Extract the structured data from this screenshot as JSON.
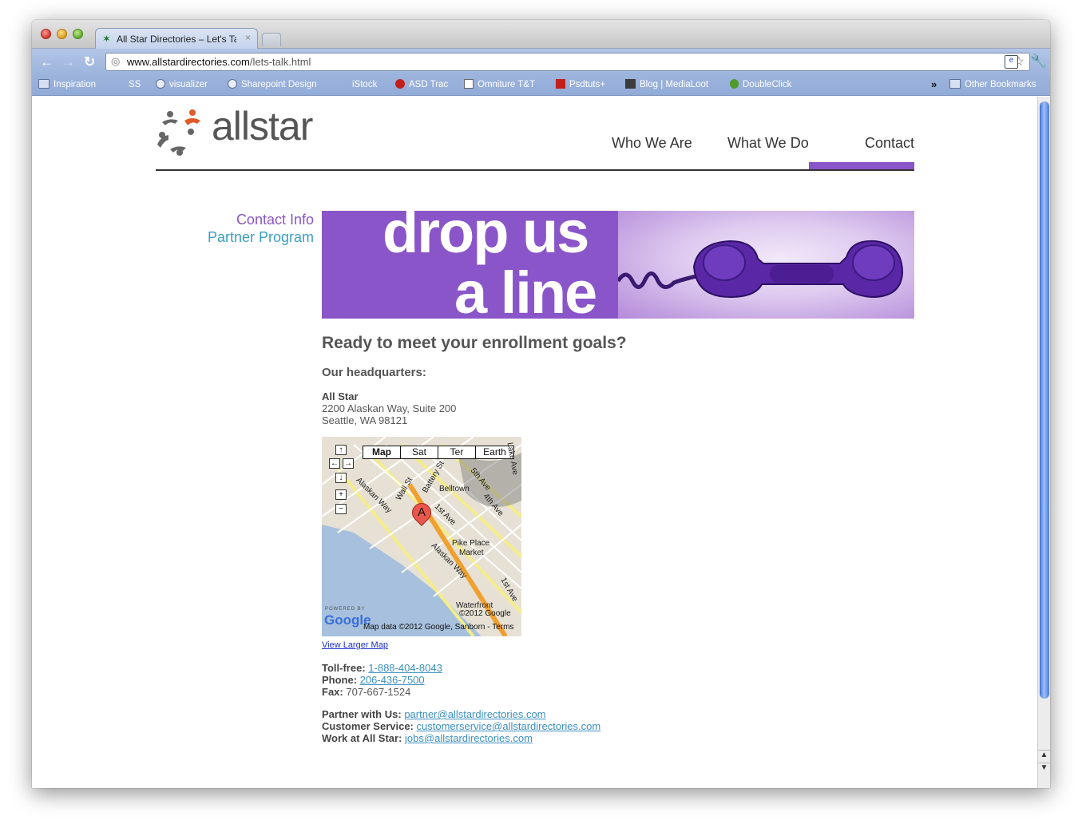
{
  "browser": {
    "tab_title": "All Star Directories – Let's Ta",
    "tab_close": "×",
    "url_host": "www.allstardirectories.com",
    "url_path": "/lets-talk.html",
    "bookmarks": [
      {
        "label": "Inspiration",
        "icon": "folder-icon"
      },
      {
        "label": "SS",
        "icon": "ss-icon"
      },
      {
        "label": "visualizer",
        "icon": "globe-icon"
      },
      {
        "label": "Sharepoint Design",
        "icon": "globe-icon"
      },
      {
        "label": "iStock",
        "icon": "istock-icon"
      },
      {
        "label": "ASD Trac",
        "icon": "trac-icon"
      },
      {
        "label": "Omniture T&T",
        "icon": "chart-icon"
      },
      {
        "label": "Psdtuts+",
        "icon": "psdtuts-icon"
      },
      {
        "label": "Blog | MediaLoot",
        "icon": "medialoot-icon"
      },
      {
        "label": "DoubleClick",
        "icon": "doubleclick-icon"
      }
    ],
    "bookmarks_overflow": "»",
    "other_bookmarks": "Other Bookmarks"
  },
  "site": {
    "logo_text": "allstar",
    "nav": {
      "who": "Who We Are",
      "what": "What We Do",
      "contact": "Contact"
    },
    "side_nav": {
      "contact_info": "Contact Info",
      "partner_program": "Partner Program"
    },
    "banner": {
      "line1": "drop us",
      "line2": "a line"
    },
    "heading": "Ready to meet your enrollment goals?",
    "subheading": "Our headquarters:",
    "address": {
      "name": "All Star",
      "street": "2200 Alaskan Way, Suite 200",
      "city": "Seattle, WA 98121"
    },
    "map": {
      "types": [
        "Map",
        "Sat",
        "Ter",
        "Earth"
      ],
      "labels": {
        "belltown": "Belltown",
        "pike": "Pike Place",
        "market": "Market",
        "alaskan1": "Alaskan Way",
        "alaskan2": "Alaskan Way",
        "wall": "Wall St",
        "battery": "Battery St",
        "first1": "1st Ave",
        "first2": "1st Ave",
        "fourth": "4th Ave",
        "fifth": "5th Ave",
        "lake": "Lake Ave",
        "waterfront": "Waterfront"
      },
      "pin_label": "A",
      "powered_by": "POWERED BY",
      "google": "Google",
      "copyright_small": "©2012 Google",
      "map_data": "Map data ©2012 Google, Sanborn - Terms"
    },
    "view_larger_map": "View Larger Map",
    "contact": {
      "tollfree_label": "Toll-free:",
      "tollfree": "1-888-404-8043",
      "phone_label": "Phone:",
      "phone": "206-436-7500",
      "fax_label": "Fax:",
      "fax": "707-667-1524",
      "partner_label": "Partner with Us:",
      "partner_email": "partner@allstardirectories.com",
      "service_label": "Customer Service:",
      "service_email": "customerservice@allstardirectories.com",
      "jobs_label": "Work at All Star:",
      "jobs_email": "jobs@allstardirectories.com"
    },
    "colors": {
      "purple": "#8a55c9",
      "teal": "#3b9fc0"
    }
  }
}
